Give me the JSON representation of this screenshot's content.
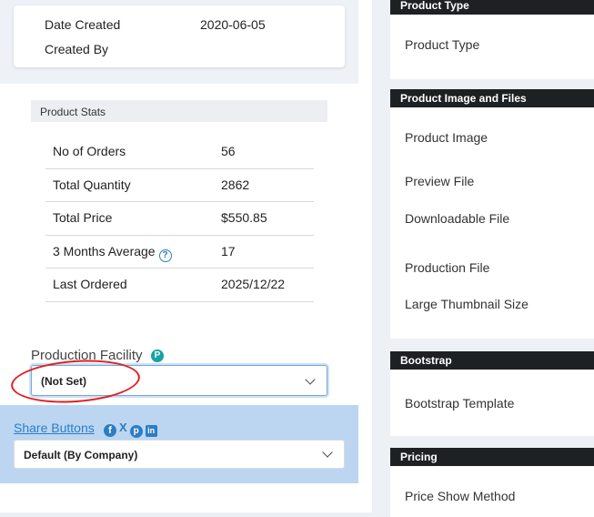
{
  "details": {
    "date_created_label": "Date Created",
    "date_created_value": "2020-06-05",
    "created_by_label": "Created By",
    "created_by_value": ""
  },
  "stats": {
    "header": "Product Stats",
    "rows": [
      {
        "label": "No of Orders",
        "value": "56"
      },
      {
        "label": "Total Quantity",
        "value": "2862"
      },
      {
        "label": "Total Price",
        "value": "$550.85"
      },
      {
        "label": "3 Months Average",
        "value": "17",
        "help_icon": "?"
      },
      {
        "label": "Last Ordered",
        "value": "2025/12/22"
      }
    ]
  },
  "production_facility": {
    "label": "Production Facility",
    "badge": "P",
    "selected": "(Not Set)"
  },
  "share": {
    "label": "Share Buttons",
    "icons": [
      "facebook-icon",
      "x-icon",
      "pinterest-icon",
      "linkedin-icon"
    ],
    "selected": "Default (By Company)"
  },
  "right_sections": [
    {
      "title": "Product Type",
      "items": [
        "Product Type"
      ]
    },
    {
      "title": "Product Image and Files",
      "items": [
        "Product Image",
        "Preview File",
        "Downloadable File",
        "Production File",
        "Large Thumbnail Size"
      ]
    },
    {
      "title": "Bootstrap",
      "items": [
        "Bootstrap Template"
      ]
    },
    {
      "title": "Pricing",
      "items": [
        "Price Show Method"
      ]
    }
  ],
  "colors": {
    "accent": "#2c7dc4",
    "section_header": "#1e2124",
    "annotation": "#e01f1f",
    "badge": "#17a2a6"
  }
}
